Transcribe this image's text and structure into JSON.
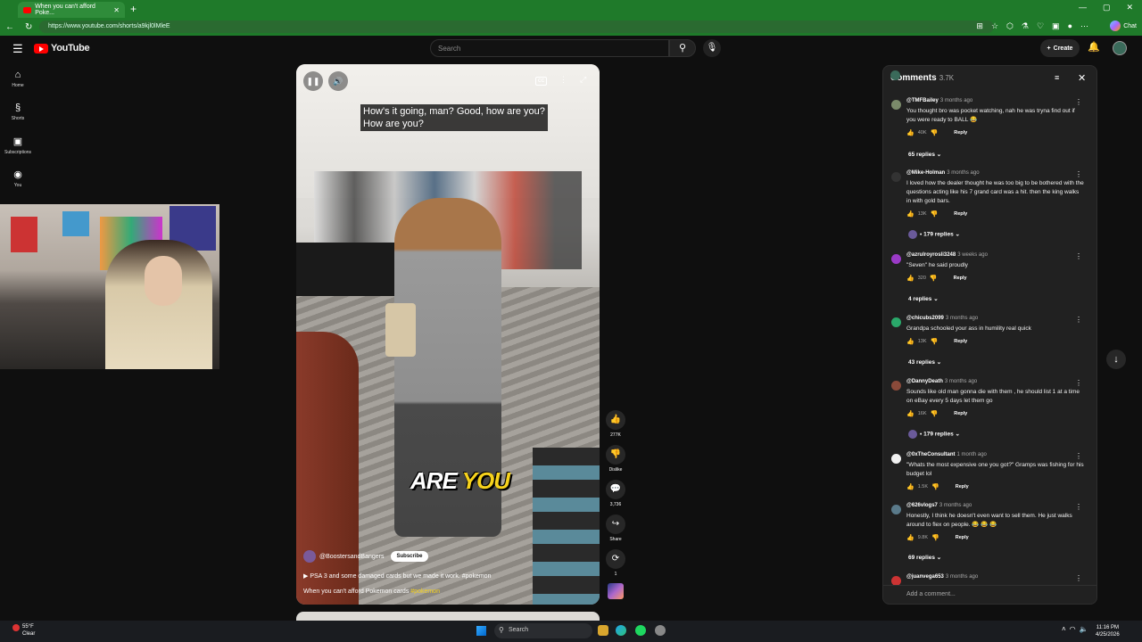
{
  "browser": {
    "tab_title": "When you can't afford Poke...",
    "new_tab": "+",
    "url": "https://www.youtube.com/shorts/a9kjl0lMleE",
    "chat_label": "Chat"
  },
  "youtube": {
    "logo_text": "YouTube",
    "search_placeholder": "Search",
    "create_label": "Create"
  },
  "nav": {
    "items": [
      {
        "label": "Home"
      },
      {
        "label": "Shorts"
      },
      {
        "label": "Subscriptions"
      },
      {
        "label": "You"
      }
    ]
  },
  "video": {
    "subtitle": "How's it going, man? Good, how are you?\nHow are you?",
    "caption_word1": "ARE",
    "caption_word2": "YOU",
    "channel": "@BoostersandBangers",
    "subscribe_label": "Subscribe",
    "music": "PSA 3 and some damaged cards but we made it work. #pokemon",
    "title": "When you can't afford Pokemon cards",
    "title_hashtag": "#pokemon",
    "cc_label": "CC"
  },
  "actions": {
    "likes": "277K",
    "dislike_label": "Dislike",
    "comments": "3,736",
    "share_label": "Share",
    "remix_count": "1"
  },
  "comments": {
    "title": "Comments",
    "count": "3.7K",
    "add_placeholder": "Add a comment...",
    "reply_label": "Reply",
    "items": [
      {
        "user": "@TMFBailey",
        "time": "3 months ago",
        "text": "You thought bro was pocket watching, nah he was tryna find out if you were ready to BALL 😂",
        "likes": "40K",
        "replies": "65 replies",
        "avatar_color": "#7a8a6a"
      },
      {
        "user": "@Mike-Holman",
        "time": "3 months ago",
        "text": "I loved how the dealer thought he was too big to be bothered with the questions acting like his 7 grand card was a hit. then the king walks in with gold bars.",
        "likes": "13K",
        "replies": "179 replies",
        "avatar_color": "#333333"
      },
      {
        "user": "@azrulroyrosli3248",
        "time": "3 weeks ago",
        "text": "\"Seven\" he said proudly",
        "likes": "320",
        "replies": "4 replies",
        "avatar_color": "#9a3ac6"
      },
      {
        "user": "@chicubs2099",
        "time": "3 months ago",
        "text": "Grandpa schooled your ass in humility real quick",
        "likes": "13K",
        "replies": "43 replies",
        "avatar_color": "#2aa86a"
      },
      {
        "user": "@DannyDeath",
        "time": "3 months ago",
        "text": "Sounds like old man gonna die with them , he should list 1 at a time on eBay every 5 days let them go",
        "likes": "16K",
        "replies": "179 replies",
        "avatar_color": "#8a4a3a"
      },
      {
        "user": "@0xTheConsultant",
        "time": "1 month ago",
        "text": "\"Whats the most expensive one you got?\" Gramps was fishing for his budget lol",
        "likes": "1.5K",
        "replies": "",
        "avatar_color": "#f1f1f1"
      },
      {
        "user": "@626vlogs7",
        "time": "3 months ago",
        "text": "Honestly, I think he doesn't even want to sell them. He just walks around to flex on people. 😂 😂 😂",
        "likes": "9.8K",
        "replies": "69 replies",
        "avatar_color": "#5a7a8a"
      },
      {
        "user": "@juanvega653",
        "time": "3 months ago",
        "text": "",
        "likes": "",
        "replies": "",
        "avatar_color": "#c33"
      }
    ]
  },
  "taskbar": {
    "temp": "55°F",
    "condition": "Clear",
    "search_placeholder": "Search",
    "time": "11:16 PM",
    "date": "4/25/2026"
  },
  "colors": {
    "browser_green": "#1f7a2a",
    "youtube_red": "#ff0000",
    "bg": "#0f0f0f",
    "caption_yellow": "#f6d21c"
  }
}
